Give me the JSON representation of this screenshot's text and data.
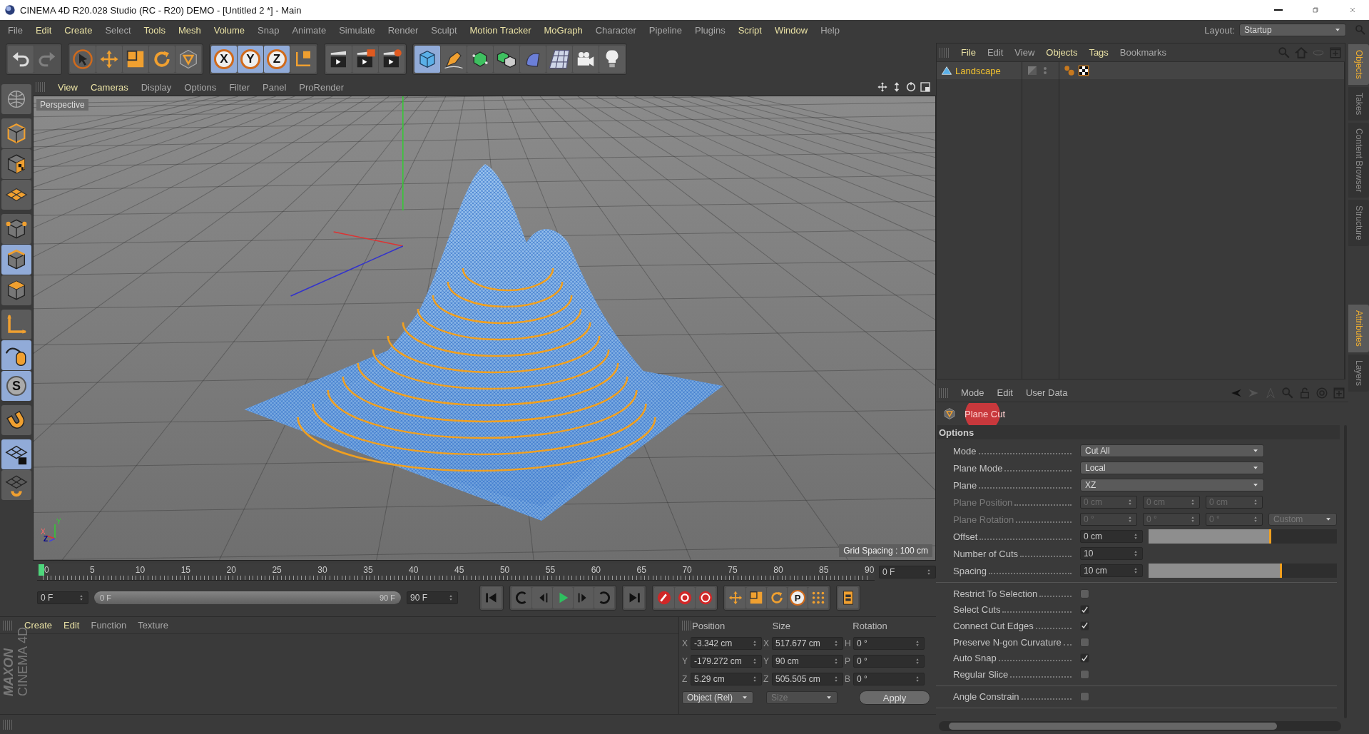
{
  "window": {
    "title": "CINEMA 4D R20.028 Studio (RC - R20) DEMO - [Untitled 2 *] - Main"
  },
  "menu": [
    {
      "label": "File",
      "highlight": false
    },
    {
      "label": "Edit",
      "highlight": true
    },
    {
      "label": "Create",
      "highlight": true
    },
    {
      "label": "Select",
      "highlight": false
    },
    {
      "label": "Tools",
      "highlight": true
    },
    {
      "label": "Mesh",
      "highlight": true
    },
    {
      "label": "Volume",
      "highlight": true
    },
    {
      "label": "Snap",
      "highlight": false
    },
    {
      "label": "Animate",
      "highlight": false
    },
    {
      "label": "Simulate",
      "highlight": false
    },
    {
      "label": "Render",
      "highlight": false
    },
    {
      "label": "Sculpt",
      "highlight": false
    },
    {
      "label": "Motion Tracker",
      "highlight": true
    },
    {
      "label": "MoGraph",
      "highlight": true
    },
    {
      "label": "Character",
      "highlight": false
    },
    {
      "label": "Pipeline",
      "highlight": false
    },
    {
      "label": "Plugins",
      "highlight": false
    },
    {
      "label": "Script",
      "highlight": true
    },
    {
      "label": "Window",
      "highlight": true
    },
    {
      "label": "Help",
      "highlight": false
    }
  ],
  "layout": {
    "label": "Layout:",
    "value": "Startup"
  },
  "toolbar": [
    {
      "items": [
        {
          "kind": "undo",
          "selected": false,
          "disabled": false
        },
        {
          "kind": "redo",
          "selected": false,
          "disabled": true
        }
      ]
    },
    {
      "items": [
        {
          "kind": "select",
          "selected": false,
          "disabled": false
        },
        {
          "kind": "move",
          "selected": false,
          "disabled": false
        },
        {
          "kind": "scale",
          "selected": false,
          "disabled": false
        },
        {
          "kind": "rotate",
          "selected": false,
          "disabled": false
        },
        {
          "kind": "object",
          "selected": false,
          "disabled": false
        }
      ]
    },
    {
      "items": [
        {
          "kind": "axis",
          "label": "X",
          "selected": true,
          "disabled": false
        },
        {
          "kind": "axis",
          "label": "Y",
          "selected": true,
          "disabled": false
        },
        {
          "kind": "axis",
          "label": "Z",
          "selected": true,
          "disabled": false
        },
        {
          "kind": "coords",
          "selected": false,
          "disabled": false
        }
      ]
    },
    {
      "items": [
        {
          "kind": "render",
          "selected": false,
          "disabled": false
        },
        {
          "kind": "renderpreview",
          "selected": false,
          "disabled": false
        },
        {
          "kind": "rendersettings",
          "selected": false,
          "disabled": false
        }
      ]
    },
    {
      "items": [
        {
          "kind": "cube",
          "selected": true,
          "disabled": false
        },
        {
          "kind": "pen",
          "selected": false,
          "disabled": false
        },
        {
          "kind": "subdivide",
          "selected": false,
          "disabled": false
        },
        {
          "kind": "array",
          "selected": false,
          "disabled": false
        },
        {
          "kind": "deformer",
          "selected": false,
          "disabled": false
        },
        {
          "kind": "floor",
          "selected": false,
          "disabled": false
        },
        {
          "kind": "camera",
          "selected": false,
          "disabled": false
        },
        {
          "kind": "light",
          "selected": false,
          "disabled": false
        }
      ]
    }
  ],
  "left_tools": [
    {
      "items": [
        {
          "kind": "globe",
          "selected": false
        }
      ]
    },
    {
      "items": [
        {
          "kind": "model",
          "selected": false
        },
        {
          "kind": "texture",
          "selected": false
        },
        {
          "kind": "workplane",
          "selected": false
        }
      ]
    },
    {
      "items": [
        {
          "kind": "points",
          "selected": false
        },
        {
          "kind": "edges",
          "selected": true
        },
        {
          "kind": "polygons",
          "selected": false
        }
      ]
    },
    {
      "items": [
        {
          "kind": "axes",
          "selected": false
        },
        {
          "kind": "tweak",
          "selected": true
        },
        {
          "kind": "snap",
          "label": "S",
          "selected": true
        }
      ]
    },
    {
      "items": [
        {
          "kind": "magnet",
          "selected": false
        }
      ]
    },
    {
      "items": [
        {
          "kind": "gridlock",
          "selected": true
        },
        {
          "kind": "gridsync",
          "selected": false
        }
      ]
    }
  ],
  "logo": {
    "brand": "MAXON",
    "product": "CINEMA 4D"
  },
  "viewport": {
    "menu": [
      {
        "label": "View",
        "highlight": true
      },
      {
        "label": "Cameras",
        "highlight": true
      },
      {
        "label": "Display",
        "highlight": false
      },
      {
        "label": "Options",
        "highlight": false
      },
      {
        "label": "Filter",
        "highlight": false
      },
      {
        "label": "Panel",
        "highlight": false
      },
      {
        "label": "ProRender",
        "highlight": false
      }
    ],
    "camera": "Perspective",
    "grid_spacing": "Grid Spacing : 100 cm",
    "axis_labels": [
      "Y",
      "X",
      "Z"
    ]
  },
  "timeline": {
    "ticks": [
      "0",
      "5",
      "10",
      "15",
      "20",
      "25",
      "30",
      "35",
      "40",
      "45",
      "50",
      "55",
      "60",
      "65",
      "70",
      "75",
      "80",
      "85",
      "90"
    ],
    "playhead": {
      "level": 0
    },
    "current_frame": "0 F",
    "start_frame": "0 F",
    "range_start": "0 F",
    "range_end": "90 F",
    "range": {
      "level": 1
    },
    "end_frame": "90 F",
    "transport": [
      {
        "items": [
          {
            "kind": "first"
          }
        ]
      },
      {
        "items": [
          {
            "kind": "prevkey"
          },
          {
            "kind": "prevframe"
          },
          {
            "kind": "play"
          },
          {
            "kind": "nextframe"
          },
          {
            "kind": "nextkey"
          }
        ]
      },
      {
        "items": [
          {
            "kind": "last"
          }
        ]
      },
      {
        "items": [
          {
            "kind": "record"
          },
          {
            "kind": "autokey"
          },
          {
            "kind": "keyselection"
          }
        ]
      },
      {
        "items": [
          {
            "kind": "keymove"
          },
          {
            "kind": "keyscale"
          },
          {
            "kind": "keyrotate"
          },
          {
            "kind": "keyparam",
            "label": "P"
          },
          {
            "kind": "keypla"
          }
        ]
      },
      {
        "items": [
          {
            "kind": "timeline"
          }
        ]
      }
    ]
  },
  "materials": {
    "menu": [
      {
        "label": "Create",
        "highlight": true
      },
      {
        "label": "Edit",
        "highlight": true
      },
      {
        "label": "Function",
        "highlight": false
      },
      {
        "label": "Texture",
        "highlight": false
      }
    ]
  },
  "coordinates": {
    "headers": [
      "Position",
      "Size",
      "Rotation"
    ],
    "rows": [
      [
        {
          "axis": "X",
          "value": "-3.342 cm"
        },
        {
          "axis": "X",
          "value": "517.677 cm"
        },
        {
          "axis": "H",
          "value": "0 °"
        }
      ],
      [
        {
          "axis": "Y",
          "value": "-179.272 cm"
        },
        {
          "axis": "Y",
          "value": "90 cm"
        },
        {
          "axis": "P",
          "value": "0 °"
        }
      ],
      [
        {
          "axis": "Z",
          "value": "5.29 cm"
        },
        {
          "axis": "Z",
          "value": "505.505 cm"
        },
        {
          "axis": "B",
          "value": "0 °"
        }
      ]
    ],
    "mode": {
      "value": "Object (Rel)",
      "disabled": false
    },
    "size_mode": {
      "value": "Size",
      "disabled": true
    },
    "apply": "Apply"
  },
  "objects": {
    "menu": [
      {
        "label": "File",
        "highlight": true
      },
      {
        "label": "Edit",
        "highlight": false
      },
      {
        "label": "View",
        "highlight": false
      },
      {
        "label": "Objects",
        "highlight": true
      },
      {
        "label": "Tags",
        "highlight": true
      },
      {
        "label": "Bookmarks",
        "highlight": false
      }
    ],
    "items": [
      {
        "name": "Landscape",
        "selected": true
      }
    ]
  },
  "attributes": {
    "menu": [
      "Mode",
      "Edit",
      "User Data"
    ],
    "object": "Plane Cut",
    "section": "Options",
    "groups": [
      {
        "rows": [
          {
            "kind": "dropdown",
            "label": "Mode",
            "value": "Cut All",
            "disabled": false
          },
          {
            "kind": "dropdown",
            "label": "Plane Mode",
            "value": "Local",
            "disabled": false
          },
          {
            "kind": "dropdown",
            "label": "Plane",
            "value": "XZ",
            "disabled": false
          },
          {
            "kind": "vector",
            "label": "Plane Position",
            "values": [
              "0 cm",
              "0 cm",
              "0 cm"
            ],
            "disabled": true
          },
          {
            "kind": "vector",
            "label": "Plane Rotation",
            "values": [
              "0 °",
              "0 °",
              "0 °"
            ],
            "mode": "Custom",
            "disabled": true
          },
          {
            "kind": "slider",
            "label": "Offset",
            "value": "0 cm",
            "level": 0.65,
            "disabled": false
          },
          {
            "kind": "number",
            "label": "Number of Cuts",
            "value": "10",
            "disabled": false
          },
          {
            "kind": "slider",
            "label": "Spacing",
            "value": "10 cm",
            "level": 0.71,
            "disabled": false
          }
        ]
      },
      {
        "rows": [
          {
            "kind": "checkbox",
            "label": "Restrict To Selection",
            "checked": false,
            "disabled": false
          },
          {
            "kind": "checkbox",
            "label": "Select Cuts",
            "checked": true,
            "disabled": false
          },
          {
            "kind": "checkbox",
            "label": "Connect Cut Edges",
            "checked": true,
            "disabled": false
          },
          {
            "kind": "checkbox",
            "label": "Preserve N-gon Curvature",
            "checked": false,
            "disabled": false
          },
          {
            "kind": "checkbox",
            "label": "Auto Snap",
            "checked": true,
            "disabled": false
          },
          {
            "kind": "checkbox",
            "label": "Regular Slice",
            "checked": false,
            "disabled": false
          }
        ]
      },
      {
        "rows": [
          {
            "kind": "checkbox",
            "label": "Angle Constrain",
            "checked": false,
            "disabled": false
          }
        ]
      }
    ]
  },
  "side_tabs": {
    "top": [
      {
        "label": "Objects",
        "selected": true
      },
      {
        "label": "Takes",
        "selected": false
      },
      {
        "label": "Content Browser",
        "selected": false
      },
      {
        "label": "Structure",
        "selected": false
      }
    ],
    "bottom": [
      {
        "label": "Attributes",
        "selected": true
      },
      {
        "label": "Layers",
        "selected": false
      }
    ]
  }
}
